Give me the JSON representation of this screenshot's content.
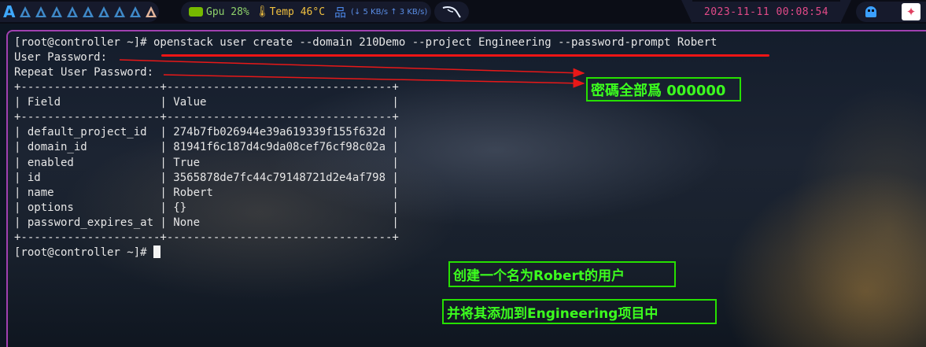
{
  "topbar": {
    "workspace_count": 9,
    "active_workspace": 9,
    "gpu_label": "Gpu 28%",
    "temp_label": "Temp 46°C",
    "net_label": "(↓ 5 KB/s ↑ 3 KB/s)",
    "clock": "2023-11-11 00:08:54"
  },
  "terminal": {
    "lines": [
      "[root@controller ~]# openstack user create --domain 210Demo --project Engineering --password-prompt Robert",
      "User Password:",
      "Repeat User Password:",
      "+---------------------+----------------------------------+",
      "| Field               | Value                            |",
      "+---------------------+----------------------------------+",
      "| default_project_id  | 274b7fb026944e39a619339f155f632d |",
      "| domain_id           | 81941f6c187d4c9da08cef76cf98c02a |",
      "| enabled             | True                             |",
      "| id                  | 3565878de7fc44c79148721d2e4af798 |",
      "| name                | Robert                           |",
      "| options             | {}                               |",
      "| password_expires_at | None                             |",
      "+---------------------+----------------------------------+"
    ],
    "prompt": "[root@controller ~]# "
  },
  "annotations": {
    "password_note": "密碼全部爲 000000",
    "create_note": "创建一个名为Robert的用户",
    "add_note": "并将其添加到Engineering项目中",
    "accent_color": "#3cff1e",
    "underline_color": "#ee1515"
  },
  "icons": [
    "arch-logo-icon",
    "workspace-icon",
    "nvidia-icon",
    "thermometer-icon",
    "network-icon",
    "kali-dragon-icon",
    "ghost-icon",
    "spark-icon"
  ]
}
